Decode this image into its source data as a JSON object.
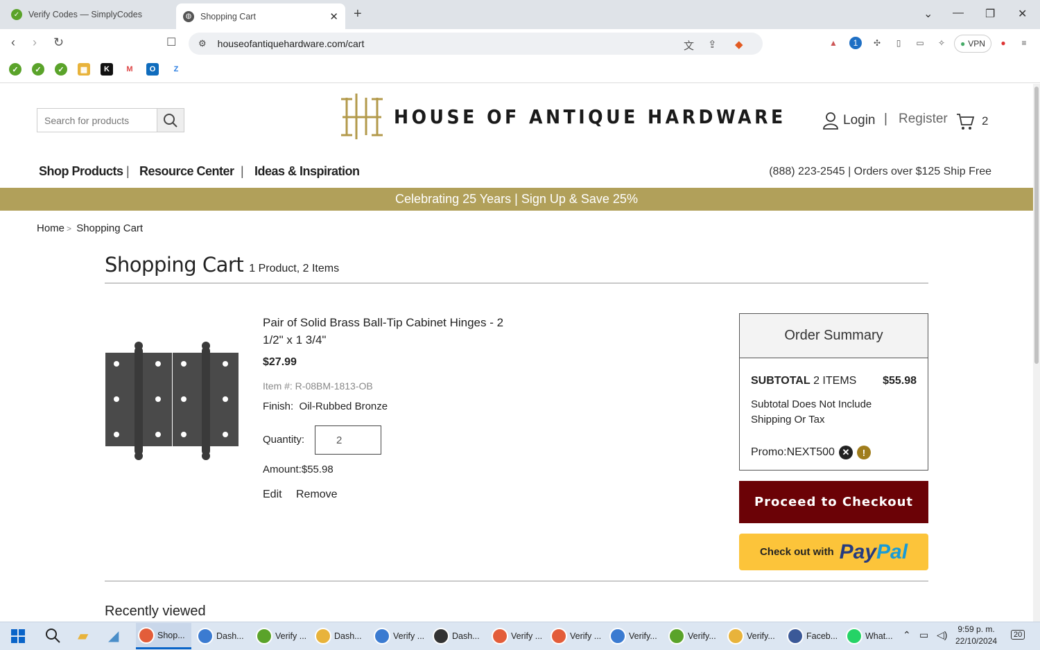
{
  "browser": {
    "tabs": [
      {
        "title": "Verify Codes — SimplyCodes",
        "active": false
      },
      {
        "title": "Shopping Cart",
        "active": true
      }
    ],
    "url": "houseofantiquehardware.com/cart",
    "vpn_label": "VPN",
    "ext_badge": "1"
  },
  "site": {
    "brand": "HOUSE OF ANTIQUE HARDWARE",
    "search_placeholder": "Search for products",
    "login": "Login",
    "separator": "|",
    "register": "Register",
    "cart_count": "2",
    "nav": [
      "Shop Products",
      "Resource Center",
      "Ideas & Inspiration"
    ],
    "contact": "(888) 223-2545 | Orders over $125 Ship Free",
    "promo_bar": "Celebrating 25 Years | Sign Up & Save 25%",
    "brand_color": "#b1a05a"
  },
  "breadcrumb": {
    "home": "Home",
    "sep": ">",
    "current": "Shopping Cart"
  },
  "cart": {
    "title": "Shopping Cart",
    "subtitle": "1 Product, 2 Items",
    "item": {
      "name": "Pair of Solid Brass Ball-Tip Cabinet Hinges - 2 1/2\" x 1 3/4\"",
      "price": "$27.99",
      "item_no": "Item #: R-08BM-1813-OB",
      "finish_label": "Finish:",
      "finish_value": "Oil-Rubbed Bronze",
      "qty_label": "Quantity:",
      "qty": "2",
      "amount": "Amount:$55.98",
      "edit": "Edit",
      "remove": "Remove"
    },
    "recently_viewed": "Recently viewed"
  },
  "summary": {
    "title": "Order Summary",
    "subtotal_label": "SUBTOTAL",
    "subtotal_items": "2 ITEMS",
    "subtotal_value": "$55.98",
    "note": "Subtotal Does Not Include Shipping Or Tax",
    "promo": "Promo:NEXT500",
    "checkout": "Proceed to Checkout",
    "paypal_pre": "Check out with",
    "paypal_a": "Pay",
    "paypal_b": "Pal",
    "checkout_color": "#6b0206",
    "paypal_color": "#fcc43a"
  },
  "taskbar": {
    "apps": [
      "Shop...",
      "Dash...",
      "Verify ...",
      "Dash...",
      "Verify ...",
      "Dash...",
      "Verify ...",
      "Verify ...",
      "Verify...",
      "Verify...",
      "Verify...",
      "Faceb...",
      "What..."
    ],
    "time": "9:59 p. m.",
    "date": "22/10/2024",
    "notif_count": "20"
  }
}
